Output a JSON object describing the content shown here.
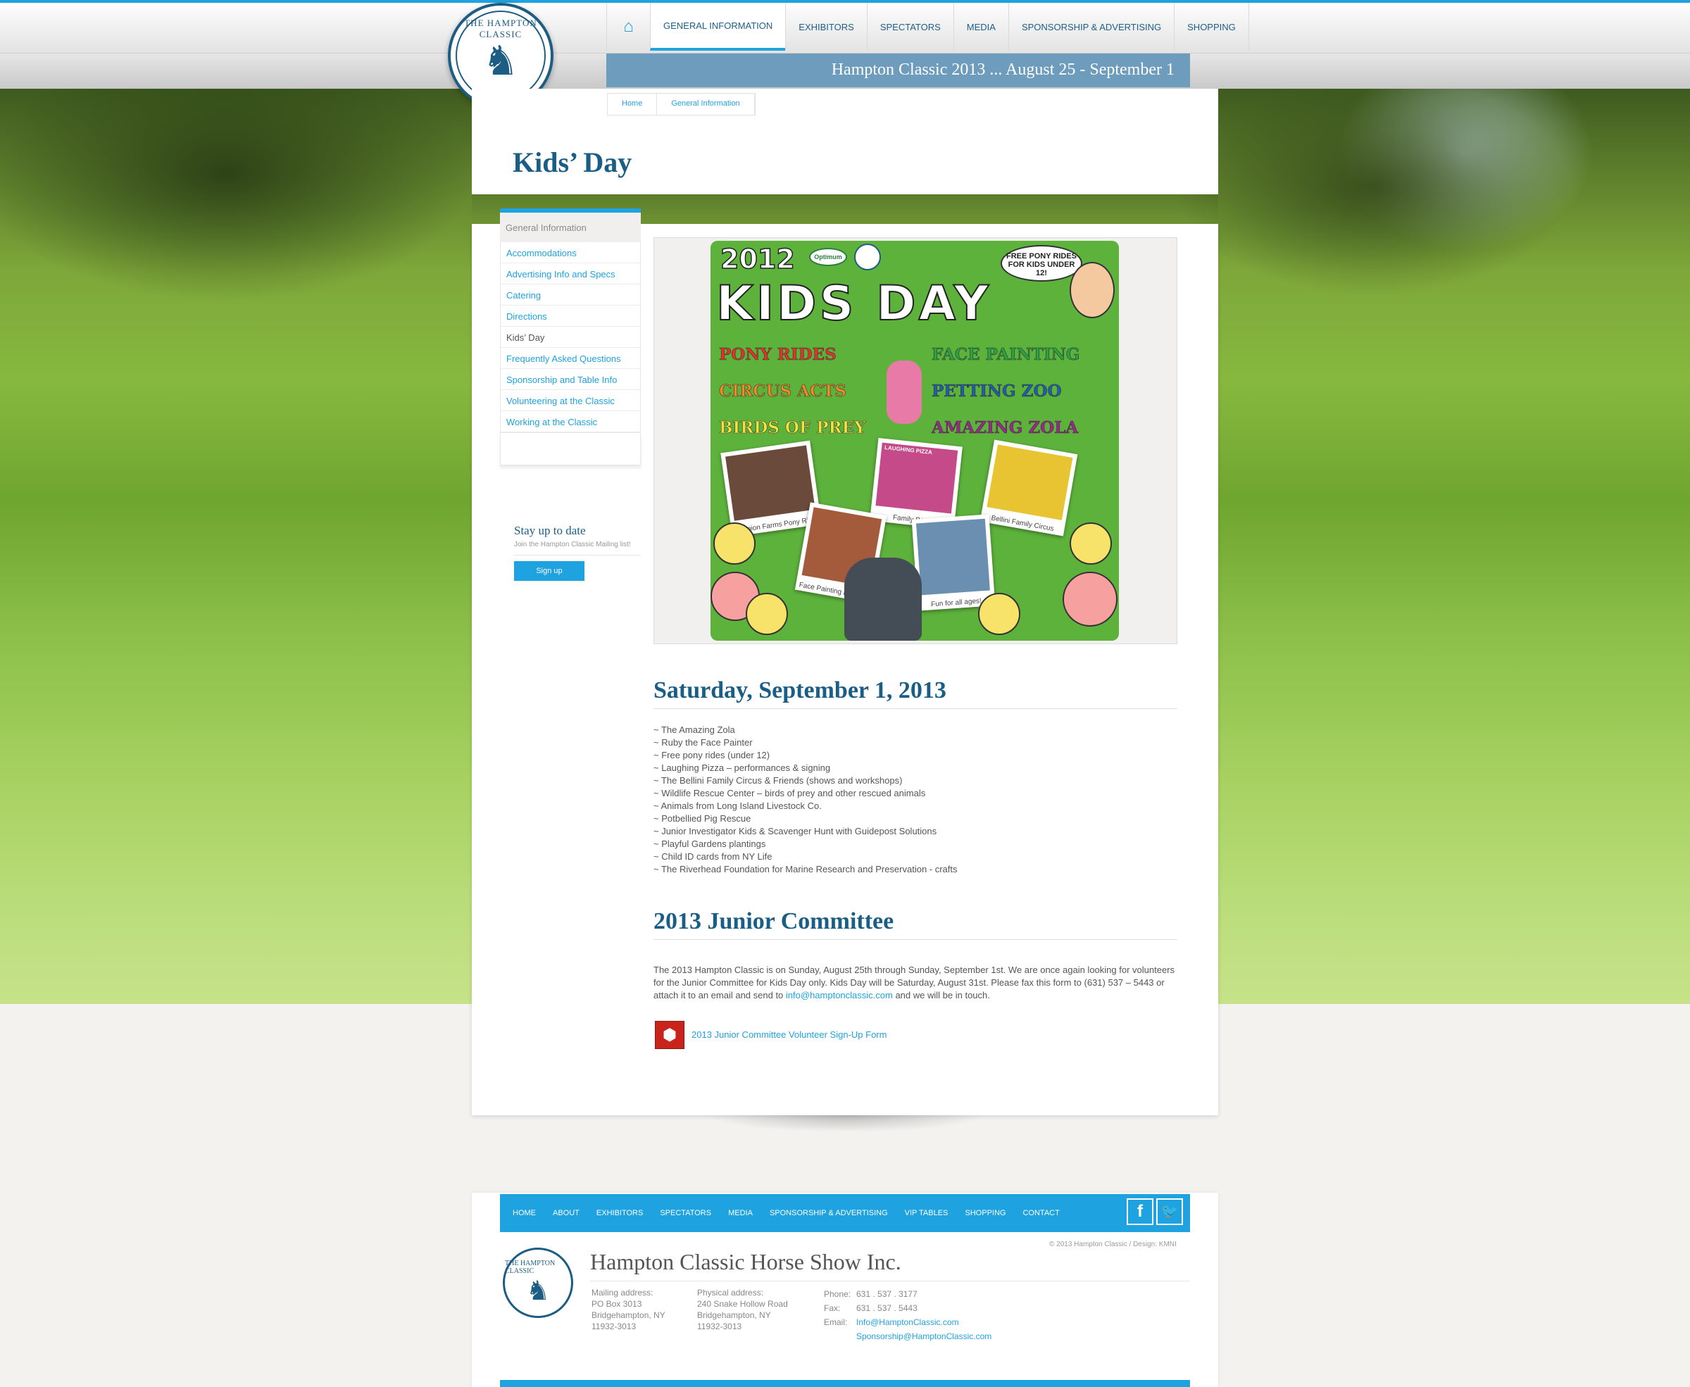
{
  "site": {
    "logo_text": "THE HAMPTON CLASSIC",
    "tagline": "Hampton Classic 2013 ... August 25 - September 1"
  },
  "nav": {
    "home_icon": "home-icon",
    "items": [
      "GENERAL INFORMATION",
      "EXHIBITORS",
      "SPECTATORS",
      "MEDIA",
      "SPONSORSHIP & ADVERTISING",
      "SHOPPING"
    ]
  },
  "breadcrumb": [
    "Home",
    "General Information"
  ],
  "page_title": "Kids’ Day",
  "sidebar": {
    "heading": "General Information",
    "items": [
      "Accommodations",
      "Advertising Info and Specs",
      "Catering",
      "Directions",
      "Kids’ Day",
      "Frequently Asked Questions",
      "Sponsorship and Table Info",
      "Volunteering at the Classic",
      "Working at the Classic"
    ]
  },
  "newsletter": {
    "title": "Stay up to date",
    "text": "Join the Hampton Classic Mailing list!",
    "button": "Sign up"
  },
  "poster": {
    "year": "2012",
    "sponsor": "Optimum",
    "title": "KIDS DAY",
    "bubble": "FREE PONY RIDES FOR KIDS UNDER 12!",
    "acts": [
      "PONY RIDES",
      "FACE PAINTING",
      "CIRCUS ACTS",
      "PETTING ZOO",
      "BIRDS OF PREY",
      "AMAZING ZOLA"
    ],
    "photo_captions": [
      "Scorpion Farms Pony Rides",
      "Family Band",
      "Bellini Family Circus",
      "Face Painting by Ruby",
      "Fun for all ages!"
    ],
    "photo_sign": "LAUGHING PIZZA"
  },
  "section1": {
    "heading": "Saturday, September 1, 2013",
    "items": [
      "~  The Amazing Zola",
      "~   Ruby the Face Painter",
      "~   Free pony rides (under 12)",
      "~  Laughing Pizza – performances & signing",
      "~  The Bellini Family Circus & Friends (shows and workshops)",
      "~  Wildlife Rescue Center – birds of prey and other rescued animals",
      "~  Animals from Long Island Livestock Co.",
      "~   Potbellied Pig Rescue",
      "~  Junior Investigator Kids & Scavenger Hunt with Guidepost Solutions",
      "~  Playful Gardens plantings",
      "~  Child ID cards from NY Life",
      "~  The Riverhead Foundation for Marine Research and Preservation - crafts"
    ]
  },
  "section2": {
    "heading": "2013 Junior Committee",
    "paragraph_before": "The 2013 Hampton Classic is on Sunday, August 25th through Sunday, September 1st. We are once again looking for volunteers for the Junior Committee for Kids Day only. Kids Day will be Saturday, August 31st. Please fax this form to (631) 537 – 5443 or attach it to an email and send to ",
    "email": "info@hamptonclassic.com",
    "paragraph_after": " and we will be in touch.",
    "pdf_icon": "pdf-icon",
    "pdf_link": "2013 Junior Committee Volunteer Sign-Up Form"
  },
  "footer": {
    "nav": [
      "HOME",
      "ABOUT",
      "EXHIBITORS",
      "SPECTATORS",
      "MEDIA",
      "SPONSORSHIP & ADVERTISING",
      "VIP TABLES",
      "SHOPPING",
      "CONTACT"
    ],
    "social": [
      "facebook-icon",
      "twitter-icon"
    ],
    "copyright": "© 2013 Hampton Classic   /   Design: KMNI",
    "company": "Hampton Classic Horse Show Inc.",
    "mailing": [
      "Mailing address:",
      "PO Box 3013",
      "Bridgehampton, NY",
      "11932-3013"
    ],
    "physical": [
      "Physical address:",
      "240 Snake Hollow Road",
      "Bridgehampton, NY",
      "11932-3013"
    ],
    "phone_label": "Phone:",
    "phone": "631 . 537 . 3177",
    "fax_label": "Fax:",
    "fax": "631 . 537 . 5443",
    "email_label": "Email:",
    "email1": "Info@HamptonClassic.com",
    "email2": "Sponsorship@HamptonClassic.com"
  },
  "colors": {
    "accent": "#1fa2e0",
    "navy": "#1a5e86",
    "tagline_bar": "#6e9cbd"
  }
}
